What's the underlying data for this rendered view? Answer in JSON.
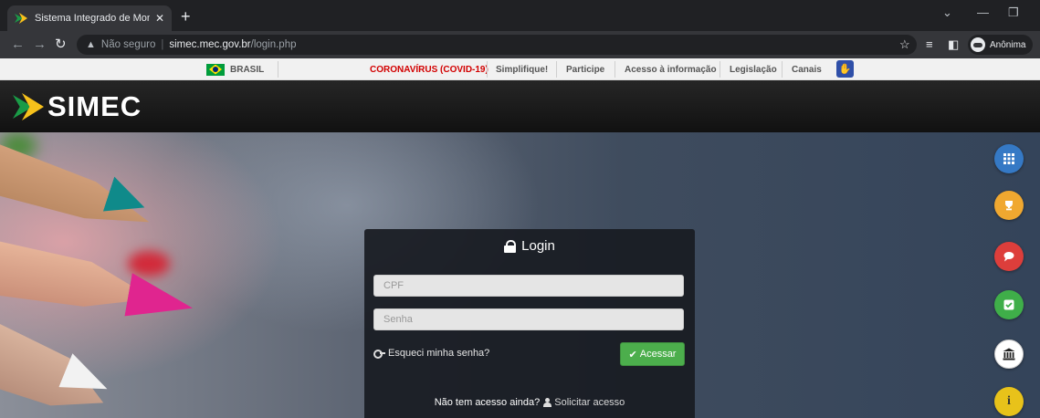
{
  "browser": {
    "tab_title": "Sistema Integrado de Monitoram",
    "tab_close": "✕",
    "new_tab": "+",
    "not_secure": "Não seguro",
    "url_host": "simec.mec.gov.br",
    "url_path": "/login.php",
    "profile_label": "Anônima"
  },
  "govbar": {
    "country": "BRASIL",
    "links": [
      "CORONAVÍRUS (COVID-19)",
      "Simplifique!",
      "Participe",
      "Acesso à informação",
      "Legislação",
      "Canais"
    ]
  },
  "header": {
    "logo_text": "SIMEC"
  },
  "login": {
    "title": "Login",
    "cpf_placeholder": "CPF",
    "senha_placeholder": "Senha",
    "forgot_label": "Esqueci minha senha?",
    "submit_label": "Acessar",
    "no_access_label": "Não tem acesso ainda?",
    "request_label": "Solicitar acesso"
  },
  "side_buttons": [
    {
      "icon": "grid-icon",
      "color": "#3579c5"
    },
    {
      "icon": "trophy-icon",
      "color": "#f0a830"
    },
    {
      "icon": "chat-icon",
      "color": "#dd3e3b"
    },
    {
      "icon": "check-square-icon",
      "color": "#3fae49"
    },
    {
      "icon": "bank-icon",
      "color": "#ffffff"
    },
    {
      "icon": "info-icon",
      "color": "#e8c21a"
    }
  ],
  "colors": {
    "accent_green": "#4cae4c",
    "covid_red": "#d20000",
    "logo_yellow": "#f7c11b",
    "logo_green": "#1a9b47"
  }
}
